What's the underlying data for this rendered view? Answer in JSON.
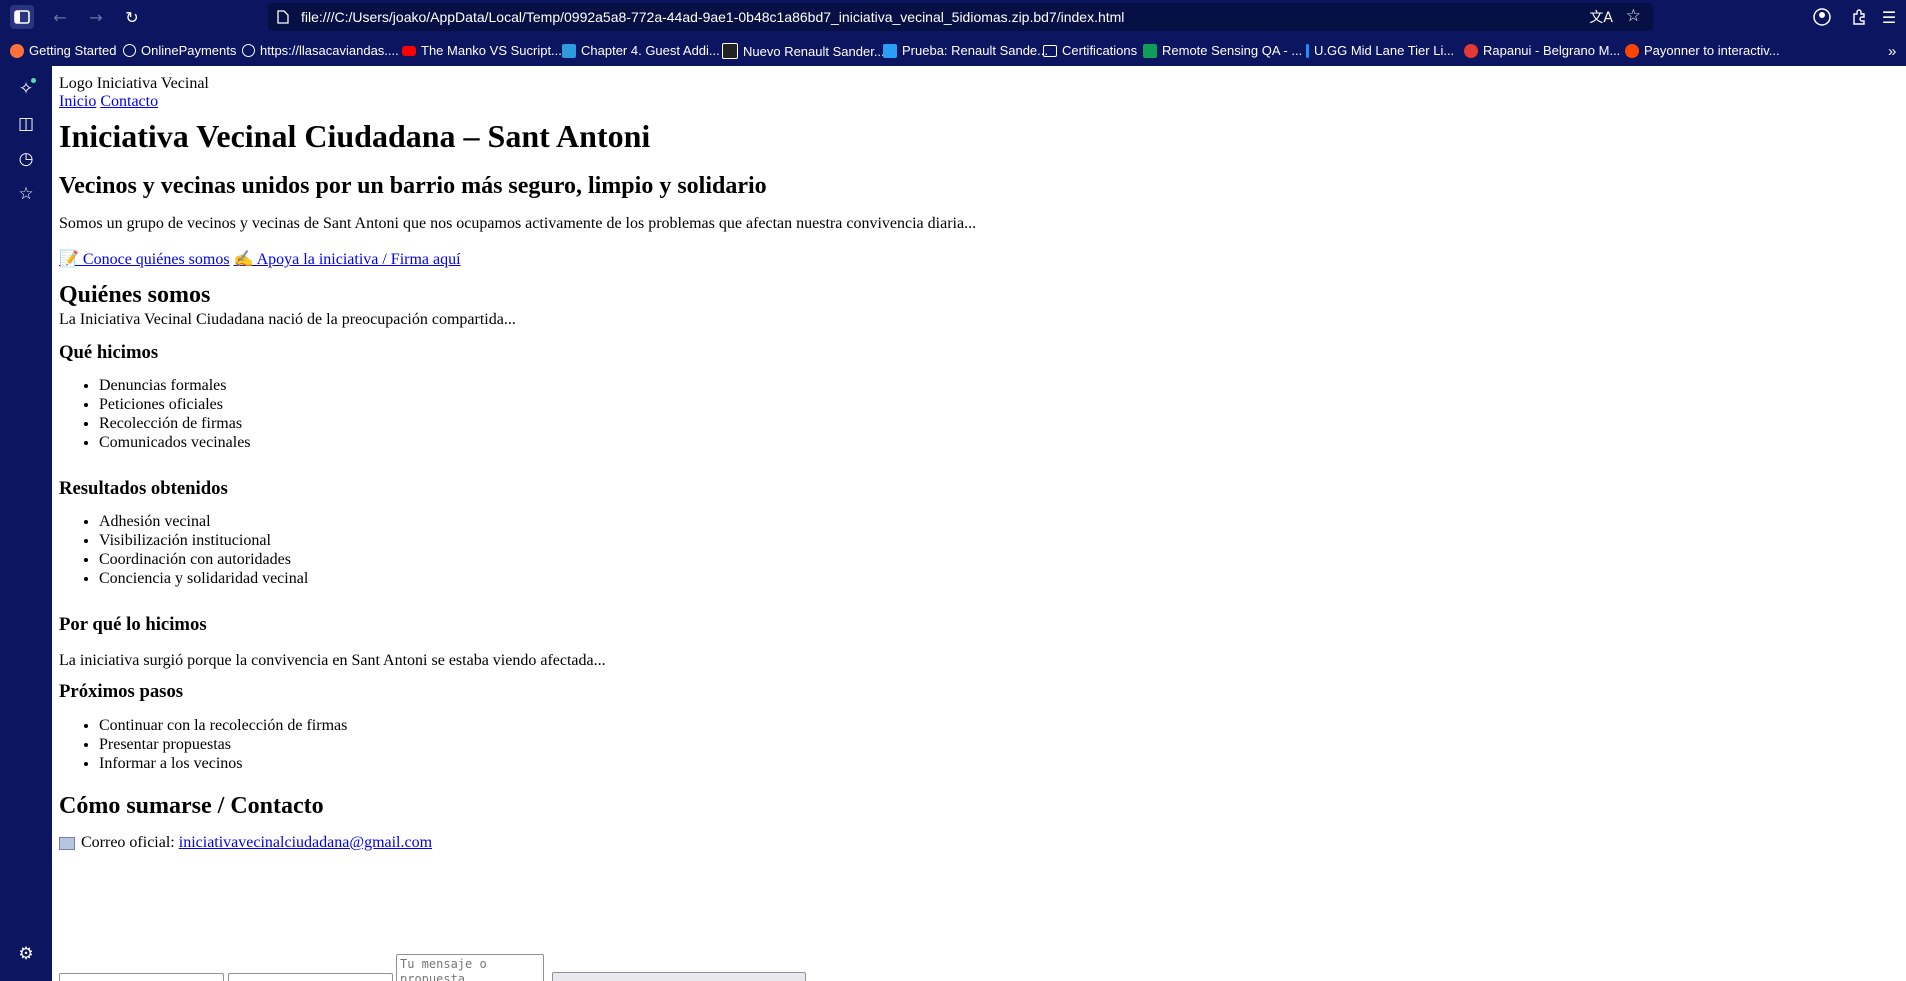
{
  "browser": {
    "url": "file:///C:/Users/joako/AppData/Local/Temp/0992a5a8-772a-44ad-9ae1-0b48c1a86bd7_iniciativa_vecinal_5idiomas.zip.bd7/index.html",
    "bookmarks": [
      {
        "label": "Getting Started",
        "icon": "firefox-icon",
        "color": "#ff7139"
      },
      {
        "label": "OnlinePayments",
        "icon": "globe-icon",
        "color": "#ffffff"
      },
      {
        "label": "https://llasacaviandas....",
        "icon": "globe-icon",
        "color": "#ffffff"
      },
      {
        "label": "The Manko VS Sucript...",
        "icon": "youtube-icon",
        "color": "#ff0000"
      },
      {
        "label": "Chapter 4. Guest Addi...",
        "icon": "vb-icon",
        "color": "#2d9cdb"
      },
      {
        "label": "Nuevo Renault Sander...",
        "icon": "sixteen-icon",
        "color": "#222222"
      },
      {
        "label": "Prueba: Renault Sande...",
        "icon": "slash-icon",
        "color": "#2a9df4"
      },
      {
        "label": "Certifications",
        "icon": "folder-icon",
        "color": "#ffffff"
      },
      {
        "label": "Remote Sensing QA - ...",
        "icon": "sheets-icon",
        "color": "#0f9d58"
      },
      {
        "label": "U.GG Mid Lane Tier Li...",
        "icon": "ugg-icon",
        "color": "#1e90ff"
      },
      {
        "label": "Rapanui - Belgrano M...",
        "icon": "rapanui-icon",
        "color": "#e53935"
      },
      {
        "label": "Payonner to interactiv...",
        "icon": "reddit-icon",
        "color": "#ff4500"
      }
    ]
  },
  "page": {
    "logo": "Logo Iniciativa Vecinal",
    "nav": {
      "home": "Inicio",
      "contact": "Contacto"
    },
    "title": "Iniciativa Vecinal Ciudadana – Sant Antoni",
    "subtitle": "Vecinos y vecinas unidos por un barrio más seguro, limpio y solidario",
    "intro": "Somos un grupo de vecinos y vecinas de Sant Antoni que nos ocupamos activamente de los problemas que afectan nuestra convivencia diaria...",
    "cta_about": "Conoce quiénes somos",
    "cta_sign": "Apoya la iniciativa / Firma aquí",
    "about_heading": "Quiénes somos",
    "about_text": "La Iniciativa Vecinal Ciudadana nació de la preocupación compartida...",
    "what_heading": "Qué hicimos",
    "what_items": [
      "Denuncias formales",
      "Peticiones oficiales",
      "Recolección de firmas",
      "Comunicados vecinales"
    ],
    "results_heading": "Resultados obtenidos",
    "results_items": [
      "Adhesión vecinal",
      "Visibilización institucional",
      "Coordinación con autoridades",
      "Conciencia y solidaridad vecinal"
    ],
    "why_heading": "Por qué lo hicimos",
    "why_text": "La iniciativa surgió porque la convivencia en Sant Antoni se estaba viendo afectada...",
    "next_heading": "Próximos pasos",
    "next_items": [
      "Continuar con la recolección de firmas",
      "Presentar propuestas",
      "Informar a los vecinos"
    ],
    "contact_heading": "Cómo sumarse / Contacto",
    "email_label": "Correo oficial:",
    "email": "iniciativavecinalciudadana@gmail.com",
    "form": {
      "message_placeholder": "Tu mensaje o propuesta"
    }
  }
}
